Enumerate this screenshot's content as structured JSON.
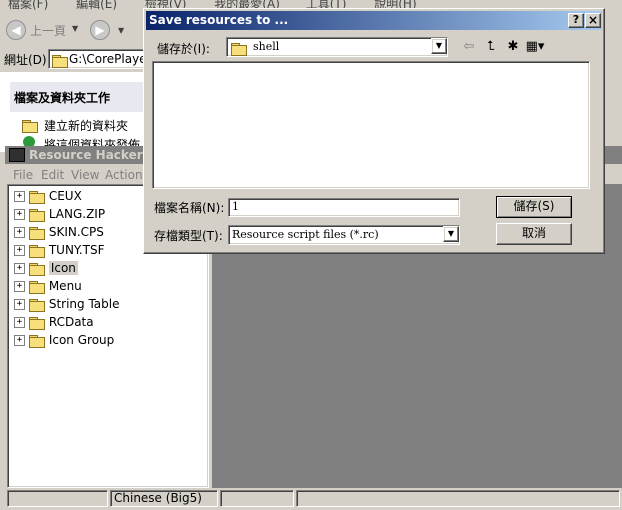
{
  "explorer": {
    "menu": [
      "檔案(F)",
      "編輯(E)",
      "檢視(V)",
      "我的最愛(A)",
      "工具(T)",
      "說明(H)"
    ],
    "back_label": "上一頁",
    "address_label": "網址(D)",
    "address_value": "G:\\CorePlayer",
    "tasks_title": "檔案及資料夾工作",
    "task_new_folder": "建立新的資料夾",
    "task_publish": "將這個資料夾發佈"
  },
  "reshacker": {
    "title": "Resource Hacker - C",
    "menu": [
      "File",
      "Edit",
      "View",
      "Action"
    ],
    "tree": [
      "CEUX",
      "LANG.ZIP",
      "SKIN.CPS",
      "TUNY.TSF",
      "Icon",
      "Menu",
      "String Table",
      "RCData",
      "Icon Group"
    ],
    "selected_index": 4,
    "status": [
      "",
      "Chinese (Big5)",
      "",
      ""
    ]
  },
  "dialog": {
    "title": "Save resources to ...",
    "help_label": "?",
    "close_label": "×",
    "save_in_label": "儲存於(I):",
    "save_in_value": "shell",
    "filename_label": "檔案名稱(N):",
    "filename_value": "1",
    "filetype_label": "存檔類型(T):",
    "filetype_value": "Resource script files (*.rc)",
    "save_button": "儲存(S)",
    "cancel_button": "取消"
  }
}
